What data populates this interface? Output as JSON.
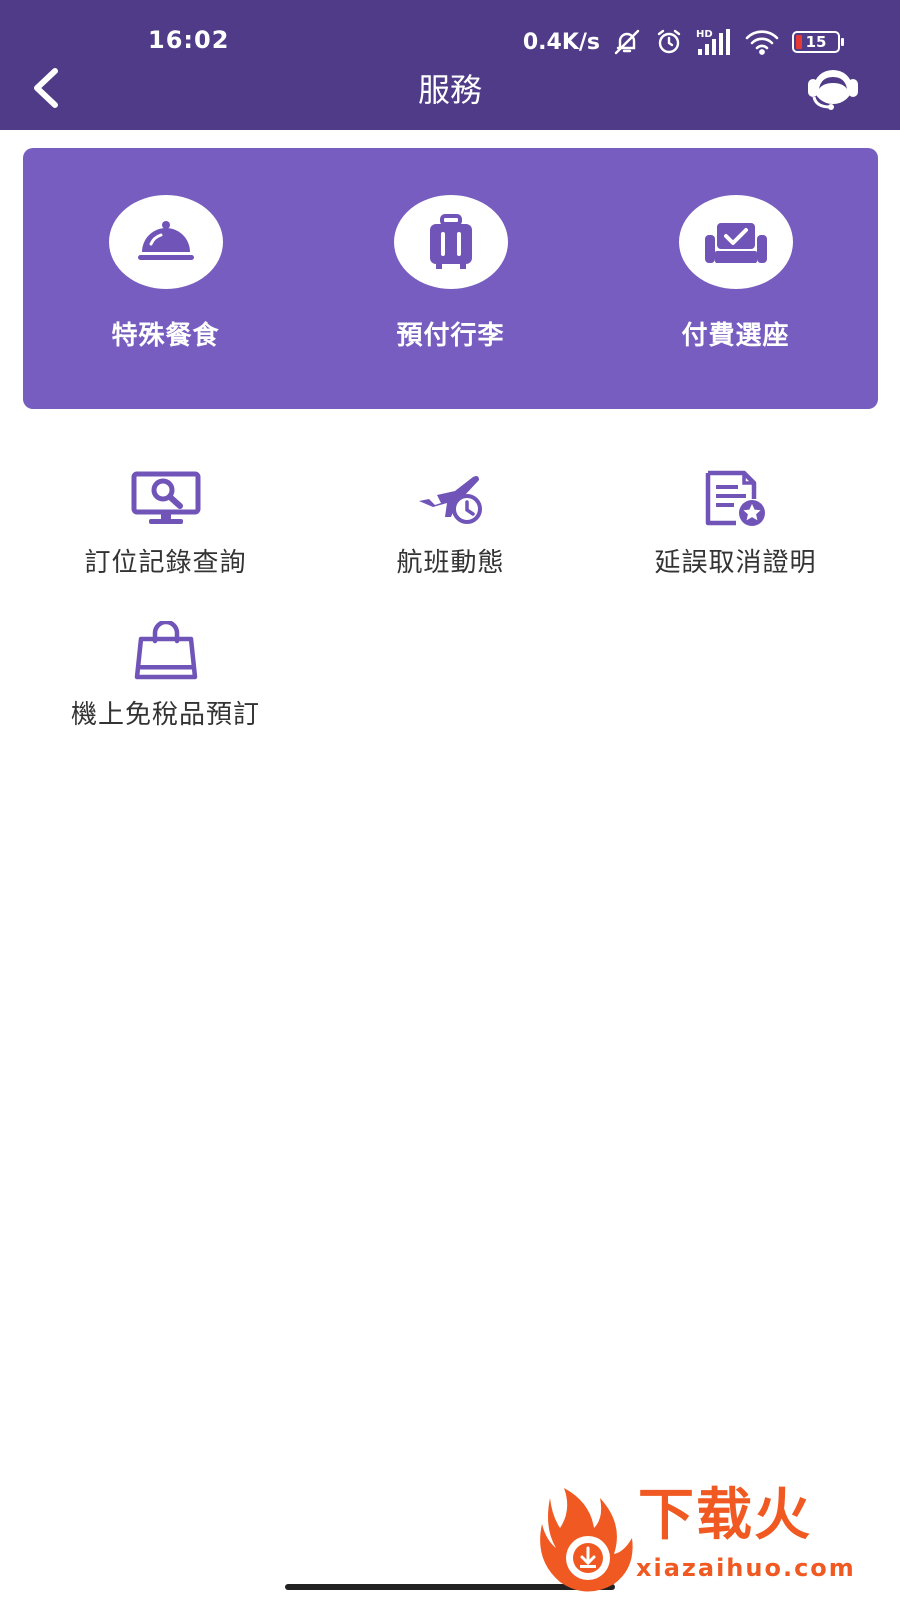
{
  "status_bar": {
    "time": "16:02",
    "network_speed": "0.4K/s",
    "network_type": "HD",
    "battery": "15",
    "icons": [
      "mute-icon",
      "alarm-icon",
      "signal-icon",
      "wifi-icon",
      "battery-icon"
    ]
  },
  "header": {
    "title": "服務",
    "back_icon": "chevron-left-icon",
    "support_icon": "customer-service-headset-icon"
  },
  "featured_services": [
    {
      "label": "特殊餐食",
      "icon": "meal-cloche-icon"
    },
    {
      "label": "預付行李",
      "icon": "luggage-icon"
    },
    {
      "label": "付費選座",
      "icon": "seat-check-icon"
    }
  ],
  "services": [
    {
      "label": "訂位記錄查詢",
      "icon": "monitor-search-icon"
    },
    {
      "label": "航班動態",
      "icon": "plane-clock-icon"
    },
    {
      "label": "延誤取消證明",
      "icon": "certificate-star-icon"
    },
    {
      "label": "機上免稅品預訂",
      "icon": "shopping-bag-icon"
    }
  ],
  "watermark": {
    "text": "下载火",
    "domain": "xiazaihuo.com"
  },
  "colors": {
    "header_bg": "#4f3b87",
    "card_bg": "#775dbf",
    "icon_purple": "#7054b8",
    "watermark": "#f05a22"
  }
}
